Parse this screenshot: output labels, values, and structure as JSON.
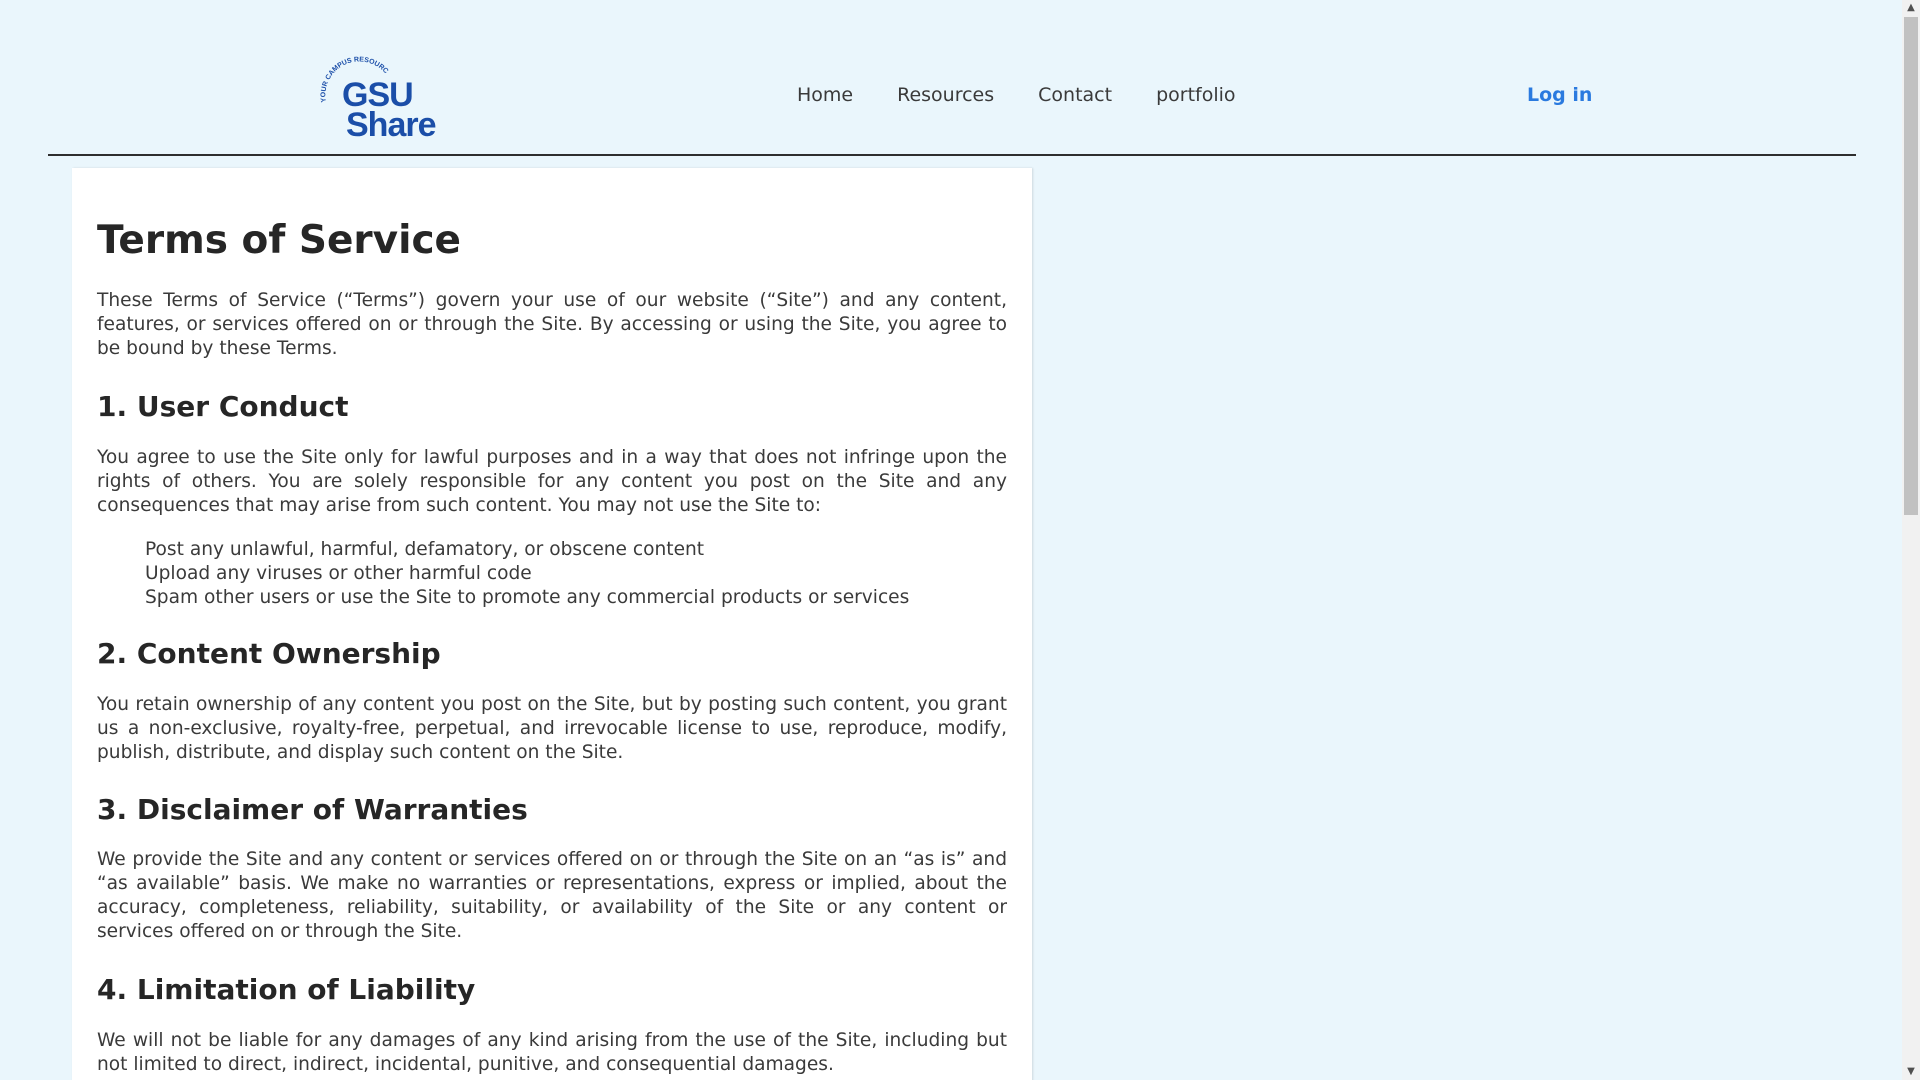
{
  "header": {
    "logo": {
      "line1": "GSU",
      "line2": "Share",
      "arc_text": "YOUR CAMPUS RESOURCE SOLUTION",
      "color": "#1b4ea8"
    },
    "nav": [
      {
        "label": "Home"
      },
      {
        "label": "Resources"
      },
      {
        "label": "Contact"
      },
      {
        "label": "portfolio"
      }
    ],
    "login_label": "Log in",
    "accent_color": "#2a7adf"
  },
  "page": {
    "title": "Terms of Service",
    "intro": "These Terms of Service (“Terms”) govern your use of our website (“Site”) and any content, features, or services offered on or through the Site. By accessing or using the Site, you agree to be bound by these Terms.",
    "sections": [
      {
        "heading": "1. User Conduct",
        "body": "You agree to use the Site only for lawful purposes and in a way that does not infringe upon the rights of others. You are solely responsible for any content you post on the Site and any consequences that may arise from such content. You may not use the Site to:",
        "items": [
          "Post any unlawful, harmful, defamatory, or obscene content",
          "Upload any viruses or other harmful code",
          "Spam other users or use the Site to promote any commercial products or services"
        ]
      },
      {
        "heading": "2. Content Ownership",
        "body": "You retain ownership of any content you post on the Site, but by posting such content, you grant us a non-exclusive, royalty-free, perpetual, and irrevocable license to use, reproduce, modify, publish, distribute, and display such content on the Site."
      },
      {
        "heading": "3. Disclaimer of Warranties",
        "body": "We provide the Site and any content or services offered on or through the Site on an “as is” and “as available” basis. We make no warranties or representations, express or implied, about the accuracy, completeness, reliability, suitability, or availability of the Site or any content or services offered on or through the Site."
      },
      {
        "heading": "4. Limitation of Liability",
        "body": "We will not be liable for any damages of any kind arising from the use of the Site, including but not limited to direct, indirect, incidental, punitive, and consequential damages."
      }
    ]
  },
  "colors": {
    "background": "#eaf6fc",
    "card": "#ffffff",
    "text": "#3a3a3a"
  }
}
